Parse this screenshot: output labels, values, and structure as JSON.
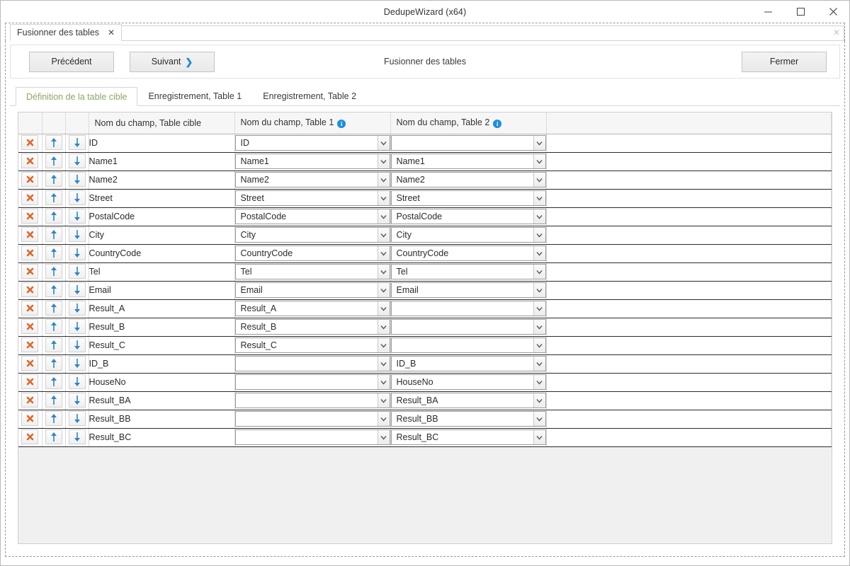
{
  "window": {
    "title": "DedupeWizard  (x64)",
    "minimize_label": "minimize",
    "maximize_label": "maximize",
    "close_label": "close"
  },
  "doc_tabs": [
    {
      "label": "Fusionner des tables",
      "close": "✕"
    }
  ],
  "tabstrip": {
    "close_all": "✕"
  },
  "toolbar": {
    "prev_label": "Précédent",
    "next_label": "Suivant",
    "next_chevron": "❯",
    "title": "Fusionner des tables",
    "close_label": "Fermer"
  },
  "inner_tabs": [
    {
      "label": "Définition de la table cible",
      "active": true
    },
    {
      "label": "Enregistrement, Table 1",
      "active": false
    },
    {
      "label": "Enregistrement, Table 2",
      "active": false
    }
  ],
  "grid": {
    "columns": [
      {
        "key": "delete",
        "label": ""
      },
      {
        "key": "up",
        "label": ""
      },
      {
        "key": "down",
        "label": ""
      },
      {
        "key": "target",
        "label": "Nom du champ, Table cible",
        "info": false
      },
      {
        "key": "table1",
        "label": "Nom du champ, Table 1",
        "info": true,
        "info_glyph": "i"
      },
      {
        "key": "table2",
        "label": "Nom du champ, Table 2",
        "info": true,
        "info_glyph": "i"
      },
      {
        "key": "spacer",
        "label": ""
      }
    ],
    "icons": {
      "delete": "delete-row-icon",
      "up": "move-up-icon",
      "down": "move-down-icon"
    },
    "rows": [
      {
        "target": "ID",
        "table1": "ID",
        "table2": ""
      },
      {
        "target": "Name1",
        "table1": "Name1",
        "table2": "Name1"
      },
      {
        "target": "Name2",
        "table1": "Name2",
        "table2": "Name2"
      },
      {
        "target": "Street",
        "table1": "Street",
        "table2": "Street"
      },
      {
        "target": "PostalCode",
        "table1": "PostalCode",
        "table2": "PostalCode"
      },
      {
        "target": "City",
        "table1": "City",
        "table2": "City"
      },
      {
        "target": "CountryCode",
        "table1": "CountryCode",
        "table2": "CountryCode"
      },
      {
        "target": "Tel",
        "table1": "Tel",
        "table2": "Tel"
      },
      {
        "target": "Email",
        "table1": "Email",
        "table2": "Email"
      },
      {
        "target": "Result_A",
        "table1": "Result_A",
        "table2": ""
      },
      {
        "target": "Result_B",
        "table1": "Result_B",
        "table2": ""
      },
      {
        "target": "Result_C",
        "table1": "Result_C",
        "table2": ""
      },
      {
        "target": "ID_B",
        "table1": "",
        "table2": "ID_B"
      },
      {
        "target": "HouseNo",
        "table1": "",
        "table2": "HouseNo"
      },
      {
        "target": "Result_BA",
        "table1": "",
        "table2": "Result_BA"
      },
      {
        "target": "Result_BB",
        "table1": "",
        "table2": "Result_BB"
      },
      {
        "target": "Result_BC",
        "table1": "",
        "table2": "Result_BC"
      }
    ]
  },
  "colors": {
    "accent_blue": "#1b8ee0",
    "active_tab_text": "#8aa860",
    "delete_icon": "#e0662a",
    "arrow_icon": "#2f84c8",
    "window_bg": "#ffffff",
    "panel_bg": "#f0f0f0"
  }
}
